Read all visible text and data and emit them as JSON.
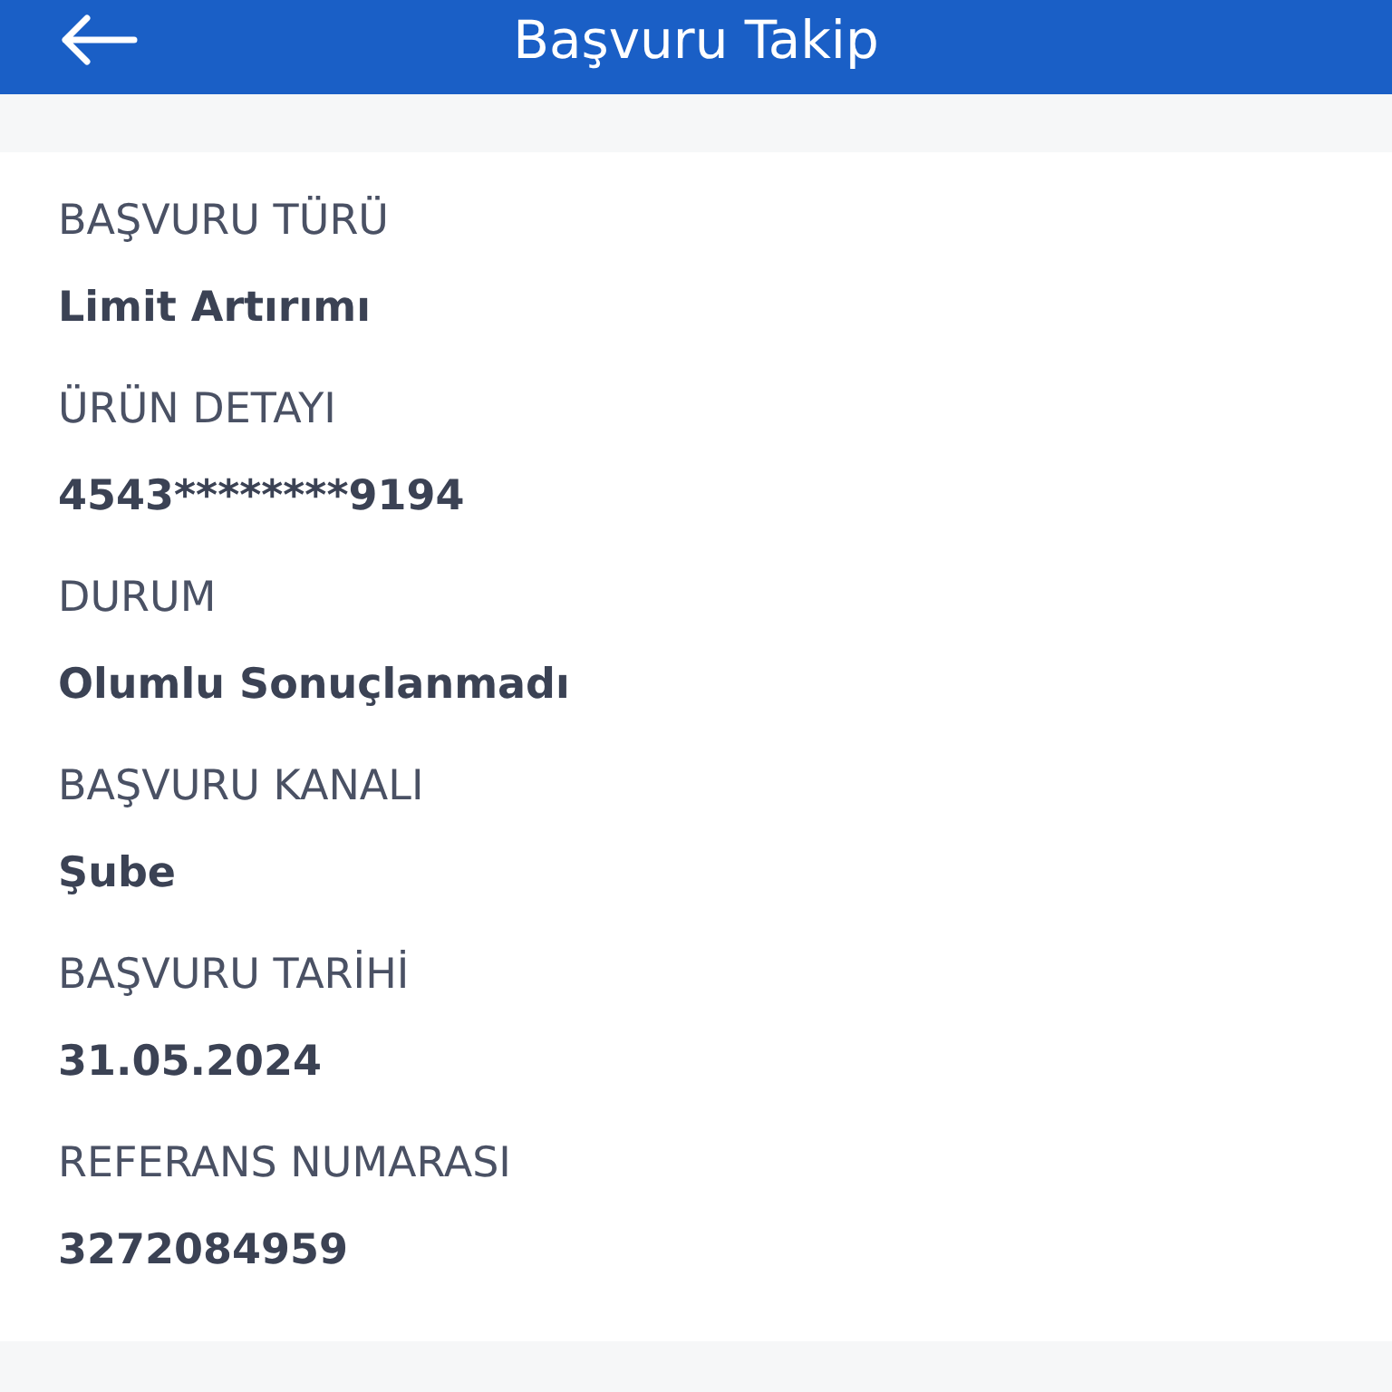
{
  "header": {
    "title": "Başvuru Takip"
  },
  "details": [
    {
      "label": "BAŞVURU TÜRÜ",
      "value": "Limit Artırımı"
    },
    {
      "label": "ÜRÜN DETAYI",
      "value": "4543********9194"
    },
    {
      "label": "DURUM",
      "value": "Olumlu Sonuçlanmadı"
    },
    {
      "label": "BAŞVURU KANALI",
      "value": "Şube"
    },
    {
      "label": "BAŞVURU TARİHİ",
      "value": "31.05.2024"
    },
    {
      "label": "REFERANS NUMARASI",
      "value": "3272084959"
    }
  ]
}
